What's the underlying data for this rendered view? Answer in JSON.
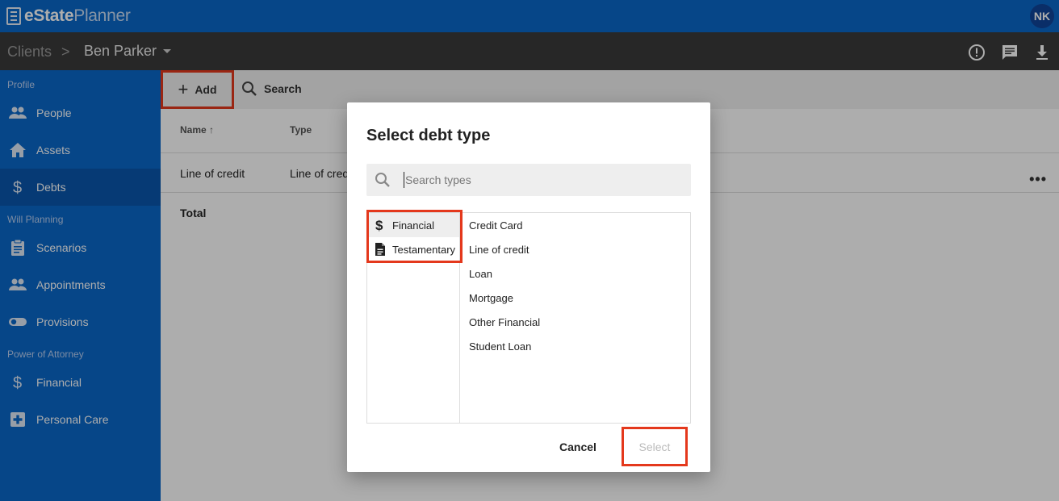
{
  "app": {
    "brand_bold": "eState",
    "brand_light": "Planner",
    "user_initials": "NK"
  },
  "breadcrumb": {
    "root": "Clients",
    "separator": ">",
    "current": "Ben Parker"
  },
  "toolbar_icons": [
    "alert-icon",
    "chat-icon",
    "download-icon"
  ],
  "sidebar": {
    "sections": {
      "profile": "Profile",
      "will_planning": "Will Planning",
      "power_of_attorney": "Power of Attorney"
    },
    "items": [
      {
        "label": "People",
        "icon": "people-icon",
        "active": false
      },
      {
        "label": "Assets",
        "icon": "home-icon",
        "active": false
      },
      {
        "label": "Debts",
        "icon": "dollar-icon",
        "active": true
      },
      {
        "label": "Scenarios",
        "icon": "clipboard-icon",
        "active": false
      },
      {
        "label": "Appointments",
        "icon": "people-icon",
        "active": false
      },
      {
        "label": "Provisions",
        "icon": "toggle-icon",
        "active": false
      },
      {
        "label": "Financial",
        "icon": "dollar-icon",
        "active": false
      },
      {
        "label": "Personal Care",
        "icon": "medical-icon",
        "active": false
      }
    ]
  },
  "actions": {
    "add_label": "Add",
    "search_label": "Search"
  },
  "table": {
    "columns": [
      "Name",
      "Type"
    ],
    "sort_column": "Name",
    "sort_direction": "ascending",
    "rows": [
      {
        "name": "Line of credit",
        "type": "Line of credit"
      }
    ],
    "total_label": "Total"
  },
  "dialog": {
    "title": "Select debt type",
    "search_placeholder": "Search types",
    "search_value": "",
    "categories": [
      {
        "label": "Financial",
        "icon": "dollar-icon",
        "selected": true
      },
      {
        "label": "Testamentary",
        "icon": "document-icon",
        "selected": false
      }
    ],
    "types": [
      "Credit Card",
      "Line of credit",
      "Loan",
      "Mortgage",
      "Other Financial",
      "Student Loan"
    ],
    "cancel_label": "Cancel",
    "select_label": "Select"
  },
  "colors": {
    "brand_blue": "#0a67c9",
    "active_blue": "#0956ad",
    "toolbar_dark": "#3a3a3a",
    "highlight_red": "#e4381c"
  }
}
